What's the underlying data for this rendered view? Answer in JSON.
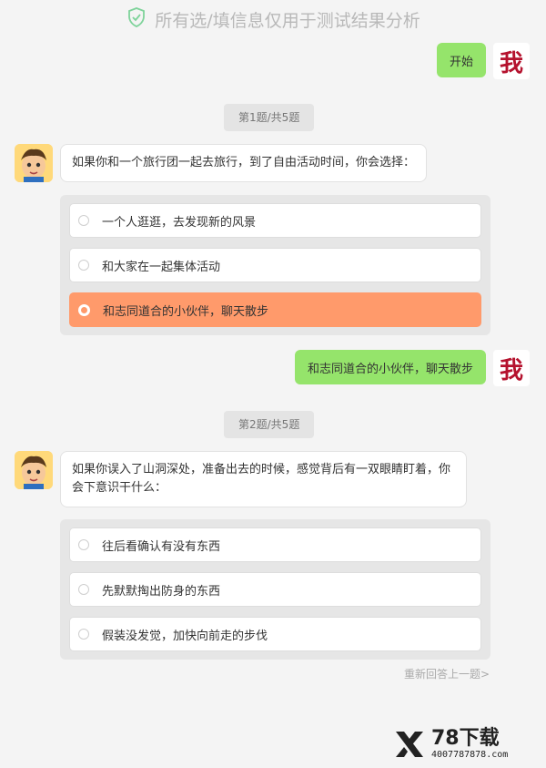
{
  "notice": {
    "text": "所有选/填信息仅用于测试结果分析"
  },
  "me": {
    "avatar_text": "我"
  },
  "chat": {
    "start_label": "开始",
    "q1": {
      "progress": "第1题/共5题",
      "question": "如果你和一个旅行团一起去旅行，到了自由活动时间，你会选择：",
      "options": [
        "一个人逛逛，去发现新的风景",
        "和大家在一起集体活动",
        "和志同道合的小伙伴，聊天散步"
      ],
      "selected_index": 2
    },
    "answer1": "和志同道合的小伙伴，聊天散步",
    "q2": {
      "progress": "第2题/共5题",
      "question_line1": "如果你误入了山洞深处，准备出去的时候，感觉背后有一双眼睛盯着，你",
      "question_line2": "会下意识干什么：",
      "options": [
        "往后看确认有没有东西",
        "先默默掏出防身的东西",
        "假装没发觉，加快向前走的步伐"
      ]
    },
    "redo_label": "重新回答上一题>"
  },
  "watermark": {
    "title": "78下载",
    "subtitle": "4007787878.com"
  },
  "colors": {
    "accent_green": "#95e46b",
    "selected_option": "#ff9a6b",
    "shield": "#7ed39a"
  }
}
